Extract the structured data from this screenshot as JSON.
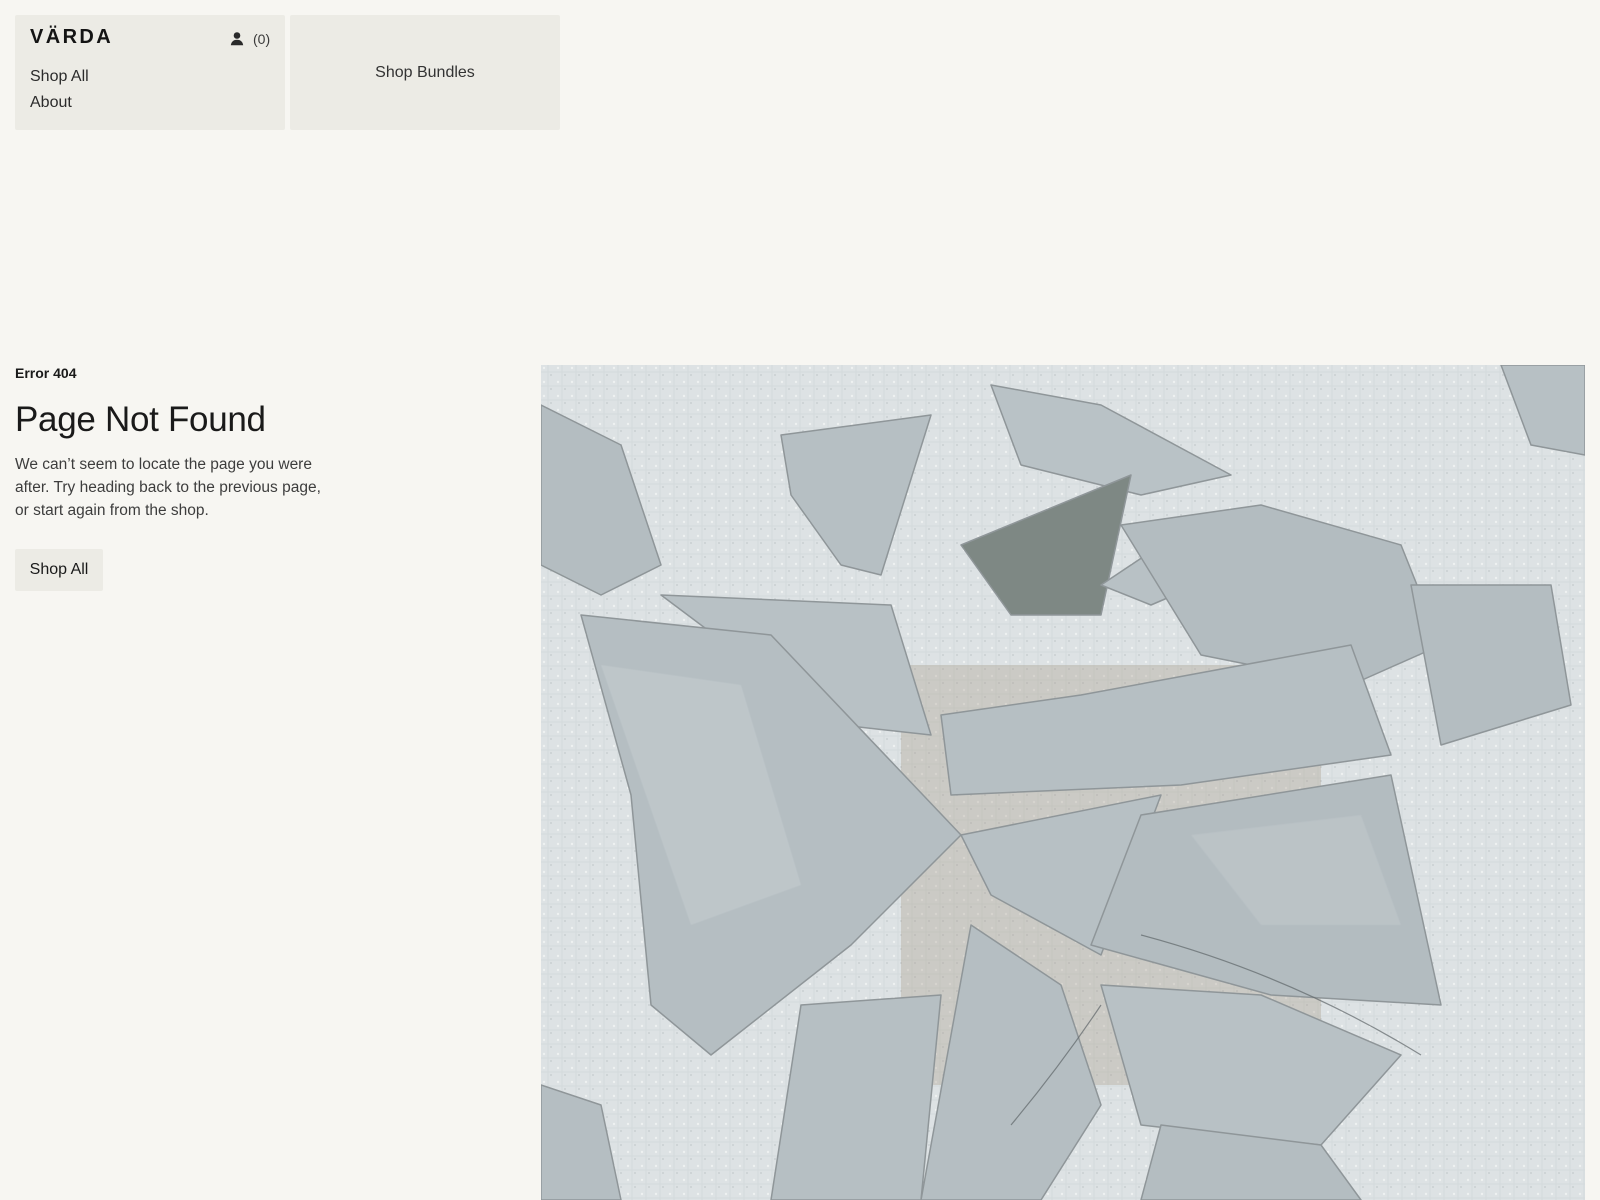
{
  "header": {
    "brand": "VÄRDA",
    "account_icon": "person-icon",
    "cart_count": "(0)",
    "nav": [
      {
        "label": "Shop All"
      },
      {
        "label": "About"
      }
    ],
    "bundles_label": "Shop Bundles"
  },
  "main": {
    "eyebrow": "Error 404",
    "title": "Page Not Found",
    "description": "We can’t seem to locate the page you were after. Try heading back to the previous page, or start again from the shop.",
    "cta_label": "Shop All"
  },
  "colors": {
    "background": "#f7f6f2",
    "panel": "#ecebe5",
    "text": "#1a1a1a"
  }
}
